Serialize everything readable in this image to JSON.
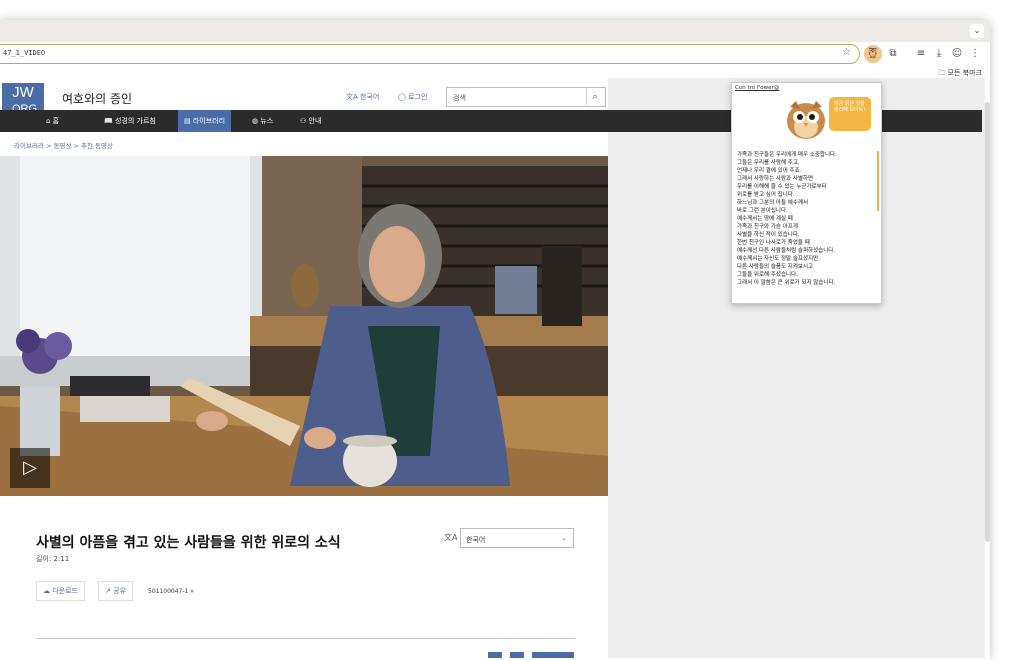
{
  "browser": {
    "url": "47_1_VIDEO",
    "bookmarks_label": "모든 북마크"
  },
  "site": {
    "logo_line1": "JW",
    "logo_line2": ".ORG",
    "title": "여호와의 증인",
    "language_link": "한국어",
    "login_link": "로그인",
    "search_placeholder": "검색",
    "nav": [
      {
        "label": "홈",
        "icon": "home-icon"
      },
      {
        "label": "성경의 가르침",
        "icon": "book-icon"
      },
      {
        "label": "라이브러리",
        "icon": "library-icon"
      },
      {
        "label": "뉴스",
        "icon": "globe-icon"
      },
      {
        "label": "안내",
        "icon": "people-icon"
      }
    ],
    "breadcrumb": "라이브러리 > 동영상 > 추천 동영상",
    "video_title": "사별의 아픔을 겪고 있는 사람들을 위한 위로의 소식",
    "video_length": "길이: 2:11",
    "language_select": "한국어",
    "download_label": "다운로드",
    "share_label": "공유",
    "video_code": "501100047-1 »"
  },
  "popup": {
    "header": "Con tro f'ower@",
    "bubble_text": "방금 읽은 것을 정리해 보아요!",
    "lines": [
      "가족과 친구들은 우리에게 매우 소중합니다.",
      "그들은 우리를 사랑해 주고,",
      "언제나 우리 곁에 있어 주죠.",
      "그래서 사랑하는 사람과 사별하면",
      "우리를 이해해 줄 수 있는 누군가로부터",
      "위로를 받고 싶어 집니다.",
      "하느님과 그분의 아들 예수께서",
      "바로 그런 분이십니다.",
      "예수께서는 땅에 계실 때",
      "가족과 친구와 가슴 아프게",
      "사별을 하신 적이 있습니다.",
      "한번 친구인 나사로가 죽었을 때",
      "예수께선 다른 사람들처럼 슬퍼하셨습니다.",
      "예수께서는 자신도 정말 슬프셨지만",
      "다른 사람들의 슬픔도 지켜보시고",
      "그들을 위로해 주셨습니다.",
      "그래서 이 말씀은 큰 위로가 되지 않습니다."
    ]
  }
}
